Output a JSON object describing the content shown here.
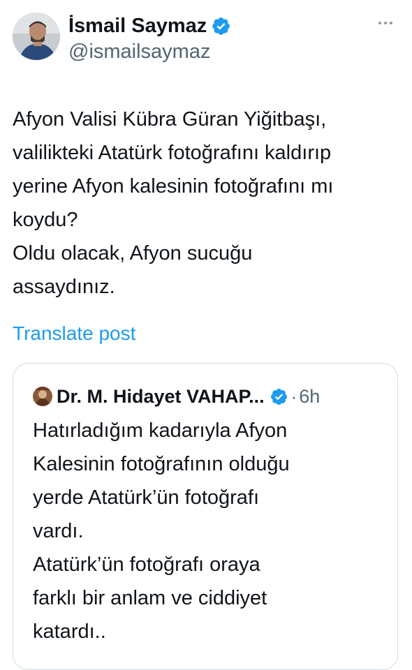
{
  "author": {
    "display_name": "İsmail Saymaz",
    "handle": "@ismailsaymaz",
    "verified": true
  },
  "tweet": {
    "lines": [
      "Afyon Valisi Kübra Güran Yiğitbaşı,",
      "valilikteki Atatürk fotoğrafını kaldırıp",
      "yerine Afyon kalesinin fotoğrafını mı",
      "koydu?",
      "Oldu olacak, Afyon sucuğu",
      "assaydınız."
    ],
    "translate_label": "Translate post"
  },
  "quote": {
    "display_name": "Dr. M. Hidayet VAHAP...",
    "verified": true,
    "separator": "·",
    "time": "6h",
    "lines": [
      "Hatırladığım kadarıyla Afyon",
      "Kalesinin fotoğrafının olduğu",
      "yerde Atatürk’ün fotoğrafı",
      "vardı.",
      "Atatürk’ün fotoğrafı oraya",
      "farklı bir anlam ve ciddiyet",
      "katardı.."
    ]
  },
  "icons": {
    "verified": "verified-badge-icon",
    "more": "more-options-icon"
  },
  "colors": {
    "link": "#1d9bf0",
    "verified": "#1d9bf0",
    "secondary_text": "#536471",
    "border": "#cfd9de"
  }
}
